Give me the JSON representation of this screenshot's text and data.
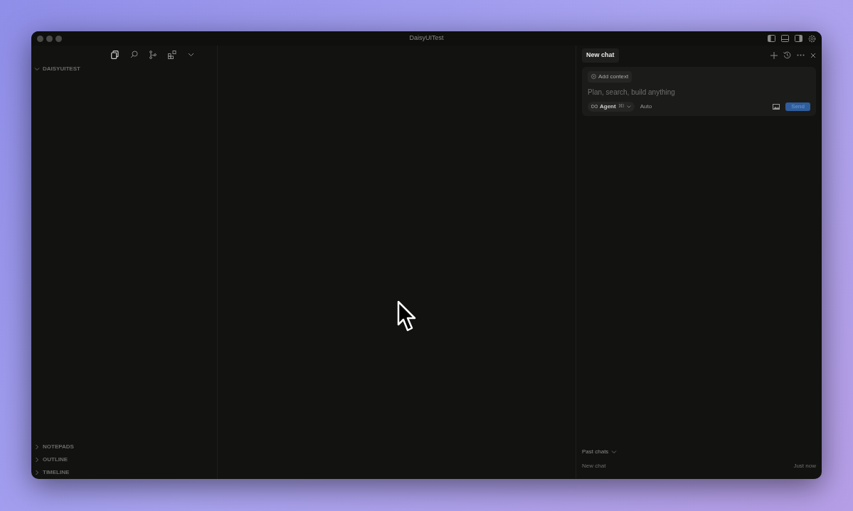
{
  "window": {
    "title": "DaisyUITest"
  },
  "explorer": {
    "root": {
      "label": "DAISYUITEST",
      "expanded": true
    },
    "sections": [
      {
        "label": "NOTEPADS",
        "expanded": false
      },
      {
        "label": "OUTLINE",
        "expanded": false
      },
      {
        "label": "TIMELINE",
        "expanded": false
      }
    ]
  },
  "chat": {
    "tab": "New chat",
    "add_context": "Add context",
    "input": {
      "placeholder": "Plan, search, build anything"
    },
    "mode": "Agent",
    "shortcut": "⌘I",
    "model": "Auto",
    "send": "Send",
    "past_chats": {
      "label": "Past chats",
      "expanded": true,
      "items": [
        {
          "title": "New chat",
          "time": "Just now"
        }
      ]
    }
  }
}
